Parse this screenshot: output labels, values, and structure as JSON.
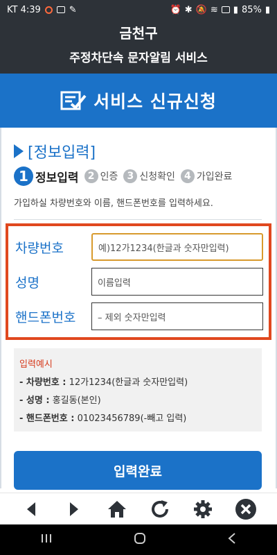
{
  "status_bar": {
    "carrier_time": "KT 4:39",
    "battery": "85%"
  },
  "header": {
    "district": "금천구",
    "service": "주정차단속 문자알림 서비스"
  },
  "banner": {
    "title": "서비스 신규신청"
  },
  "section": {
    "title": "[정보입력]"
  },
  "steps": [
    {
      "num": "1",
      "label": "정보입력"
    },
    {
      "num": "2",
      "label": "인증"
    },
    {
      "num": "3",
      "label": "신청확인"
    },
    {
      "num": "4",
      "label": "가입완료"
    }
  ],
  "instruction": "가입하실 차량번호와 이름, 핸드폰번호를 입력하세요.",
  "form": {
    "car_label": "차량번호",
    "car_placeholder": "예)12가1234(한글과 숫자만입력)",
    "name_label": "성명",
    "name_placeholder": "이름입력",
    "phone_label": "핸드폰번호",
    "phone_placeholder": "– 제외 숫자만입력"
  },
  "example": {
    "title": "입력예시",
    "car_key": "- 차량번호 :",
    "car_val": " 12가1234(한글과 숫자만입력)",
    "name_key": "- 성명 :",
    "name_val": " 홍길동(본인)",
    "phone_key": "- 핸드폰번호 :",
    "phone_val": " 01023456789(-빼고 입력)"
  },
  "submit_label": "입력완료",
  "toolbar": [
    "back-icon",
    "forward-icon",
    "home-icon",
    "refresh-icon",
    "settings-icon",
    "close-icon"
  ],
  "colors": {
    "primary": "#1b72c8",
    "highlight": "#e0481e",
    "header_bg": "#2d3238"
  }
}
